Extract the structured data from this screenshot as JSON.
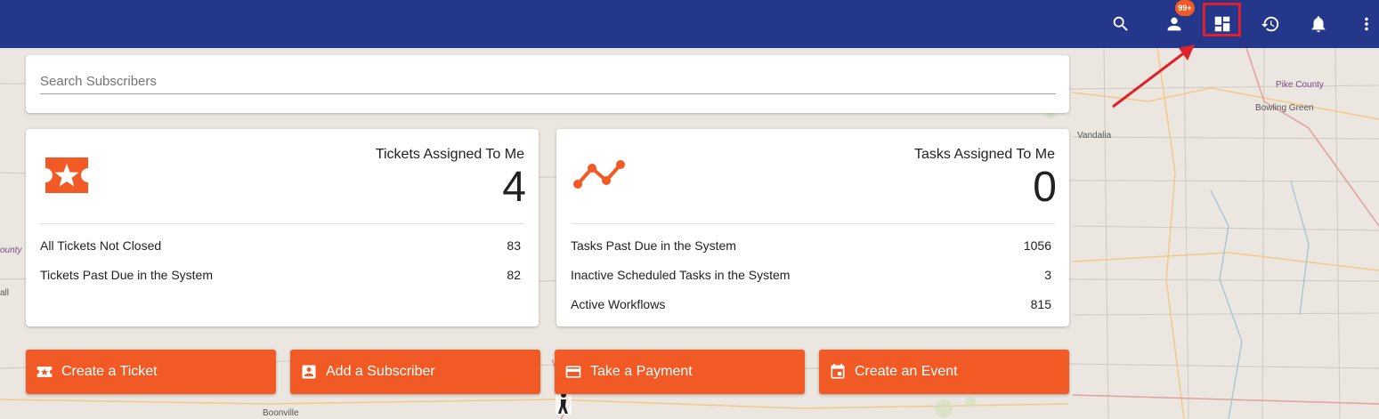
{
  "topbar": {
    "notification_badge": "99+",
    "icons": [
      "search-icon",
      "person-icon",
      "dashboard-icon",
      "history-icon",
      "bell-icon",
      "more-vert-icon"
    ],
    "background": "#25378a"
  },
  "map": {
    "labels": [
      "Pike County",
      "Bowling Green",
      "Vandalia",
      "Boonville",
      "ounty",
      "all"
    ]
  },
  "search": {
    "placeholder": "Search Subscribers",
    "value": ""
  },
  "tickets_card": {
    "icon": "ticket-star-icon",
    "title": "Tickets Assigned To Me",
    "count": "4",
    "rows": [
      {
        "label": "All Tickets Not Closed",
        "value": "83"
      },
      {
        "label": "Tickets Past Due in the System",
        "value": "82"
      }
    ]
  },
  "tasks_card": {
    "icon": "timeline-icon",
    "title": "Tasks Assigned To Me",
    "count": "0",
    "rows": [
      {
        "label": "Tasks Past Due in the System",
        "value": "1056"
      },
      {
        "label": "Inactive Scheduled Tasks in the System",
        "value": "3"
      },
      {
        "label": "Active Workflows",
        "value": "815"
      }
    ]
  },
  "actions": [
    {
      "label": "Create a Ticket",
      "icon": "ticket-icon"
    },
    {
      "label": "Add a Subscriber",
      "icon": "contact-icon"
    },
    {
      "label": "Take a Payment",
      "icon": "credit-card-icon"
    },
    {
      "label": "Create an Event",
      "icon": "calendar-event-icon"
    }
  ],
  "colors": {
    "accent": "#f15a24",
    "highlight": "#e0202a"
  }
}
